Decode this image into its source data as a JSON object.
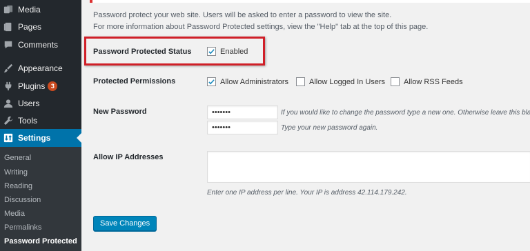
{
  "sidebar": {
    "items": [
      {
        "label": "Media",
        "icon": "media-icon"
      },
      {
        "label": "Pages",
        "icon": "pages-icon"
      },
      {
        "label": "Comments",
        "icon": "comments-icon"
      },
      {
        "label": "Appearance",
        "icon": "appearance-icon"
      },
      {
        "label": "Plugins",
        "icon": "plugins-icon",
        "badge": "3"
      },
      {
        "label": "Users",
        "icon": "users-icon"
      },
      {
        "label": "Tools",
        "icon": "tools-icon"
      },
      {
        "label": "Settings",
        "icon": "settings-icon",
        "current": true
      }
    ],
    "submenu": [
      "General",
      "Writing",
      "Reading",
      "Discussion",
      "Media",
      "Permalinks",
      "Password Protected"
    ]
  },
  "intro": {
    "line1": "Password protect your web site. Users will be asked to enter a password to view the site.",
    "line2": "For more information about Password Protected settings, view the \"Help\" tab at the top of this page."
  },
  "status": {
    "label": "Password Protected Status",
    "checkbox_label": "Enabled",
    "checked": true
  },
  "permissions": {
    "label": "Protected Permissions",
    "options": [
      {
        "label": "Allow Administrators",
        "checked": true
      },
      {
        "label": "Allow Logged In Users",
        "checked": false
      },
      {
        "label": "Allow RSS Feeds",
        "checked": false
      }
    ]
  },
  "password": {
    "label": "New Password",
    "value1": "•••••••",
    "value2": "•••••••",
    "hint1": "If you would like to change the password type a new one. Otherwise leave this blank.",
    "hint2": "Type your new password again."
  },
  "ip": {
    "label": "Allow IP Addresses",
    "value": "",
    "hint": "Enter one IP address per line. Your IP is address 42.114.179.242."
  },
  "save_label": "Save Changes",
  "colors": {
    "sidebar_bg": "#23282d",
    "submenu_bg": "#32373c",
    "accent": "#0073aa",
    "button": "#0085ba",
    "badge": "#ca4a1f",
    "highlight": "#d01f28"
  }
}
